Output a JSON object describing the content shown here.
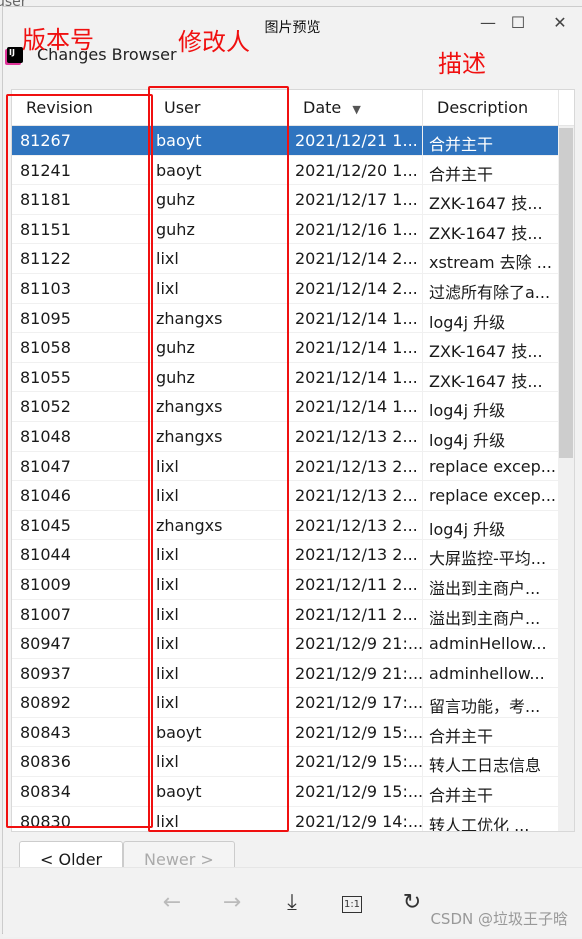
{
  "background_text": "user",
  "window": {
    "title": "图片预览",
    "controls": [
      "minimize",
      "maximize",
      "close"
    ]
  },
  "app": {
    "title": "Changes Browser",
    "logo": "IJ"
  },
  "table": {
    "columns": [
      "Revision",
      "User",
      "Date",
      "Description"
    ],
    "sort": {
      "column": "Date",
      "direction": "descending"
    },
    "selected_index": 0,
    "rows": [
      [
        "81267",
        "baoyt",
        "2021/12/21 1...",
        "合并主干"
      ],
      [
        "81241",
        "baoyt",
        "2021/12/20 1...",
        "合并主干"
      ],
      [
        "81181",
        "guhz",
        "2021/12/17 1...",
        "ZXK-1647 技..."
      ],
      [
        "81151",
        "guhz",
        "2021/12/16 1...",
        "ZXK-1647 技..."
      ],
      [
        "81122",
        "lixl",
        "2021/12/14 2...",
        "xstream 去除 ..."
      ],
      [
        "81103",
        "lixl",
        "2021/12/14 2...",
        "过滤所有除了a..."
      ],
      [
        "81095",
        "zhangxs",
        "2021/12/14 1...",
        "log4j 升级"
      ],
      [
        "81058",
        "guhz",
        "2021/12/14 1...",
        "ZXK-1647 技..."
      ],
      [
        "81055",
        "guhz",
        "2021/12/14 1...",
        "ZXK-1647 技..."
      ],
      [
        "81052",
        "zhangxs",
        "2021/12/14 1...",
        "log4j 升级"
      ],
      [
        "81048",
        "zhangxs",
        "2021/12/13 2...",
        "log4j 升级"
      ],
      [
        "81047",
        "lixl",
        "2021/12/13 2...",
        "replace excep..."
      ],
      [
        "81046",
        "lixl",
        "2021/12/13 2...",
        "replace excep..."
      ],
      [
        "81045",
        "zhangxs",
        "2021/12/13 2...",
        "log4j 升级"
      ],
      [
        "81044",
        "lixl",
        "2021/12/13 2...",
        "大屏监控-平均..."
      ],
      [
        "81009",
        "lixl",
        "2021/12/11 2...",
        "溢出到主商户..."
      ],
      [
        "81007",
        "lixl",
        "2021/12/11 2...",
        "溢出到主商户..."
      ],
      [
        "80947",
        "lixl",
        "2021/12/9 21:...",
        "adminHellow..."
      ],
      [
        "80937",
        "lixl",
        "2021/12/9 21:...",
        "adminhellow..."
      ],
      [
        "80892",
        "lixl",
        "2021/12/9 17:...",
        "留言功能，考..."
      ],
      [
        "80843",
        "baoyt",
        "2021/12/9 15:...",
        "合并主干"
      ],
      [
        "80836",
        "lixl",
        "2021/12/9 15:...",
        "转人工日志信息"
      ],
      [
        "80834",
        "baoyt",
        "2021/12/9 15:...",
        "合并主干"
      ],
      [
        "80830",
        "lixl",
        "2021/12/9 14:...",
        "转人工优化 ..."
      ]
    ]
  },
  "buttons": {
    "older": "< Older",
    "newer": "Newer >"
  },
  "toolbar": {
    "back": "←",
    "forward": "→",
    "download": "⤓",
    "actual_size": "1:1",
    "refresh": "↻"
  },
  "annotations": {
    "revision": "版本号",
    "user": "修改人",
    "description": "描述"
  },
  "watermark": "CSDN @垃圾王子晗",
  "colors": {
    "selection": "#2f74bf",
    "annotation": "#f01010"
  }
}
